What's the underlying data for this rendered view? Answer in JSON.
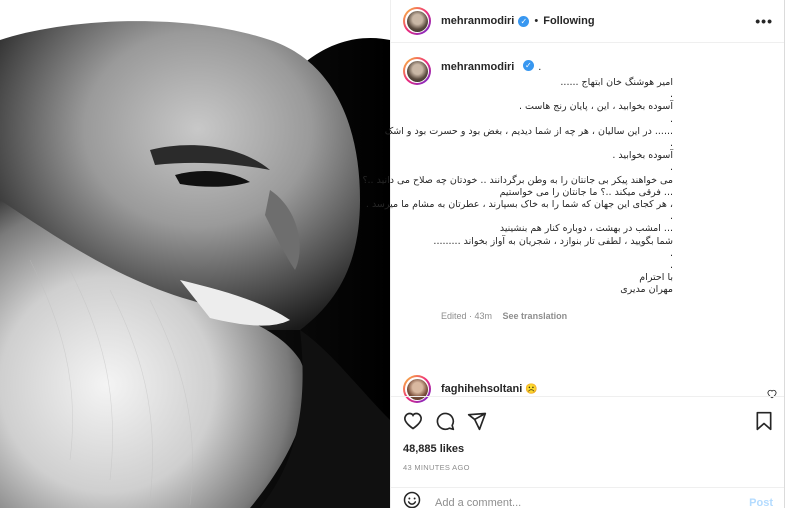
{
  "header": {
    "username": "mehranmodiri",
    "separator": "•",
    "follow_label": "Following",
    "more_label": "•••"
  },
  "caption": {
    "username": "mehranmodiri",
    "suffix": ".",
    "lines": [
      "امیر هوشنگ خان ابتهاج ......",
      ".",
      "آسوده بخوابید ، این ، پایان رنج هاست .",
      ".",
      "...... در این سالیان ، هر چه از شما دیدیم ، بغض بود و حسرت بود و اشک",
      ".",
      "آسوده بخوابید .",
      ".",
      "می خواهند پیکر بی جانتان را به وطن برگردانند .. خودتان چه صلاح می دانید ..؟",
      "... فرقی میکند ..؟ ما جانتان را می خواستیم",
      "، هر کجای این جهان که شما را به خاک بسپارند ، عطرتان به مشام ما میرسد .",
      ".",
      "... امشب در بهشت ، دوباره کنار هم بنشینید",
      "شما بگویید ، لطفی تار بنوازد ، شجریان به آواز بخواند .........",
      ".",
      ".",
      "با احترام",
      "مهران مدیری"
    ],
    "edited": "Edited · 43m",
    "see_translation": "See translation"
  },
  "comment": {
    "username": "faghihehsoltani",
    "emoji": "☹️"
  },
  "likes": "48,885 likes",
  "time_ago": "43 MINUTES AGO",
  "add_comment": {
    "placeholder": "Add a comment...",
    "post_label": "Post"
  },
  "colors": {
    "verified": "#3897f0",
    "post_disabled": "#b3dbff",
    "muted": "#8e8e8e"
  }
}
